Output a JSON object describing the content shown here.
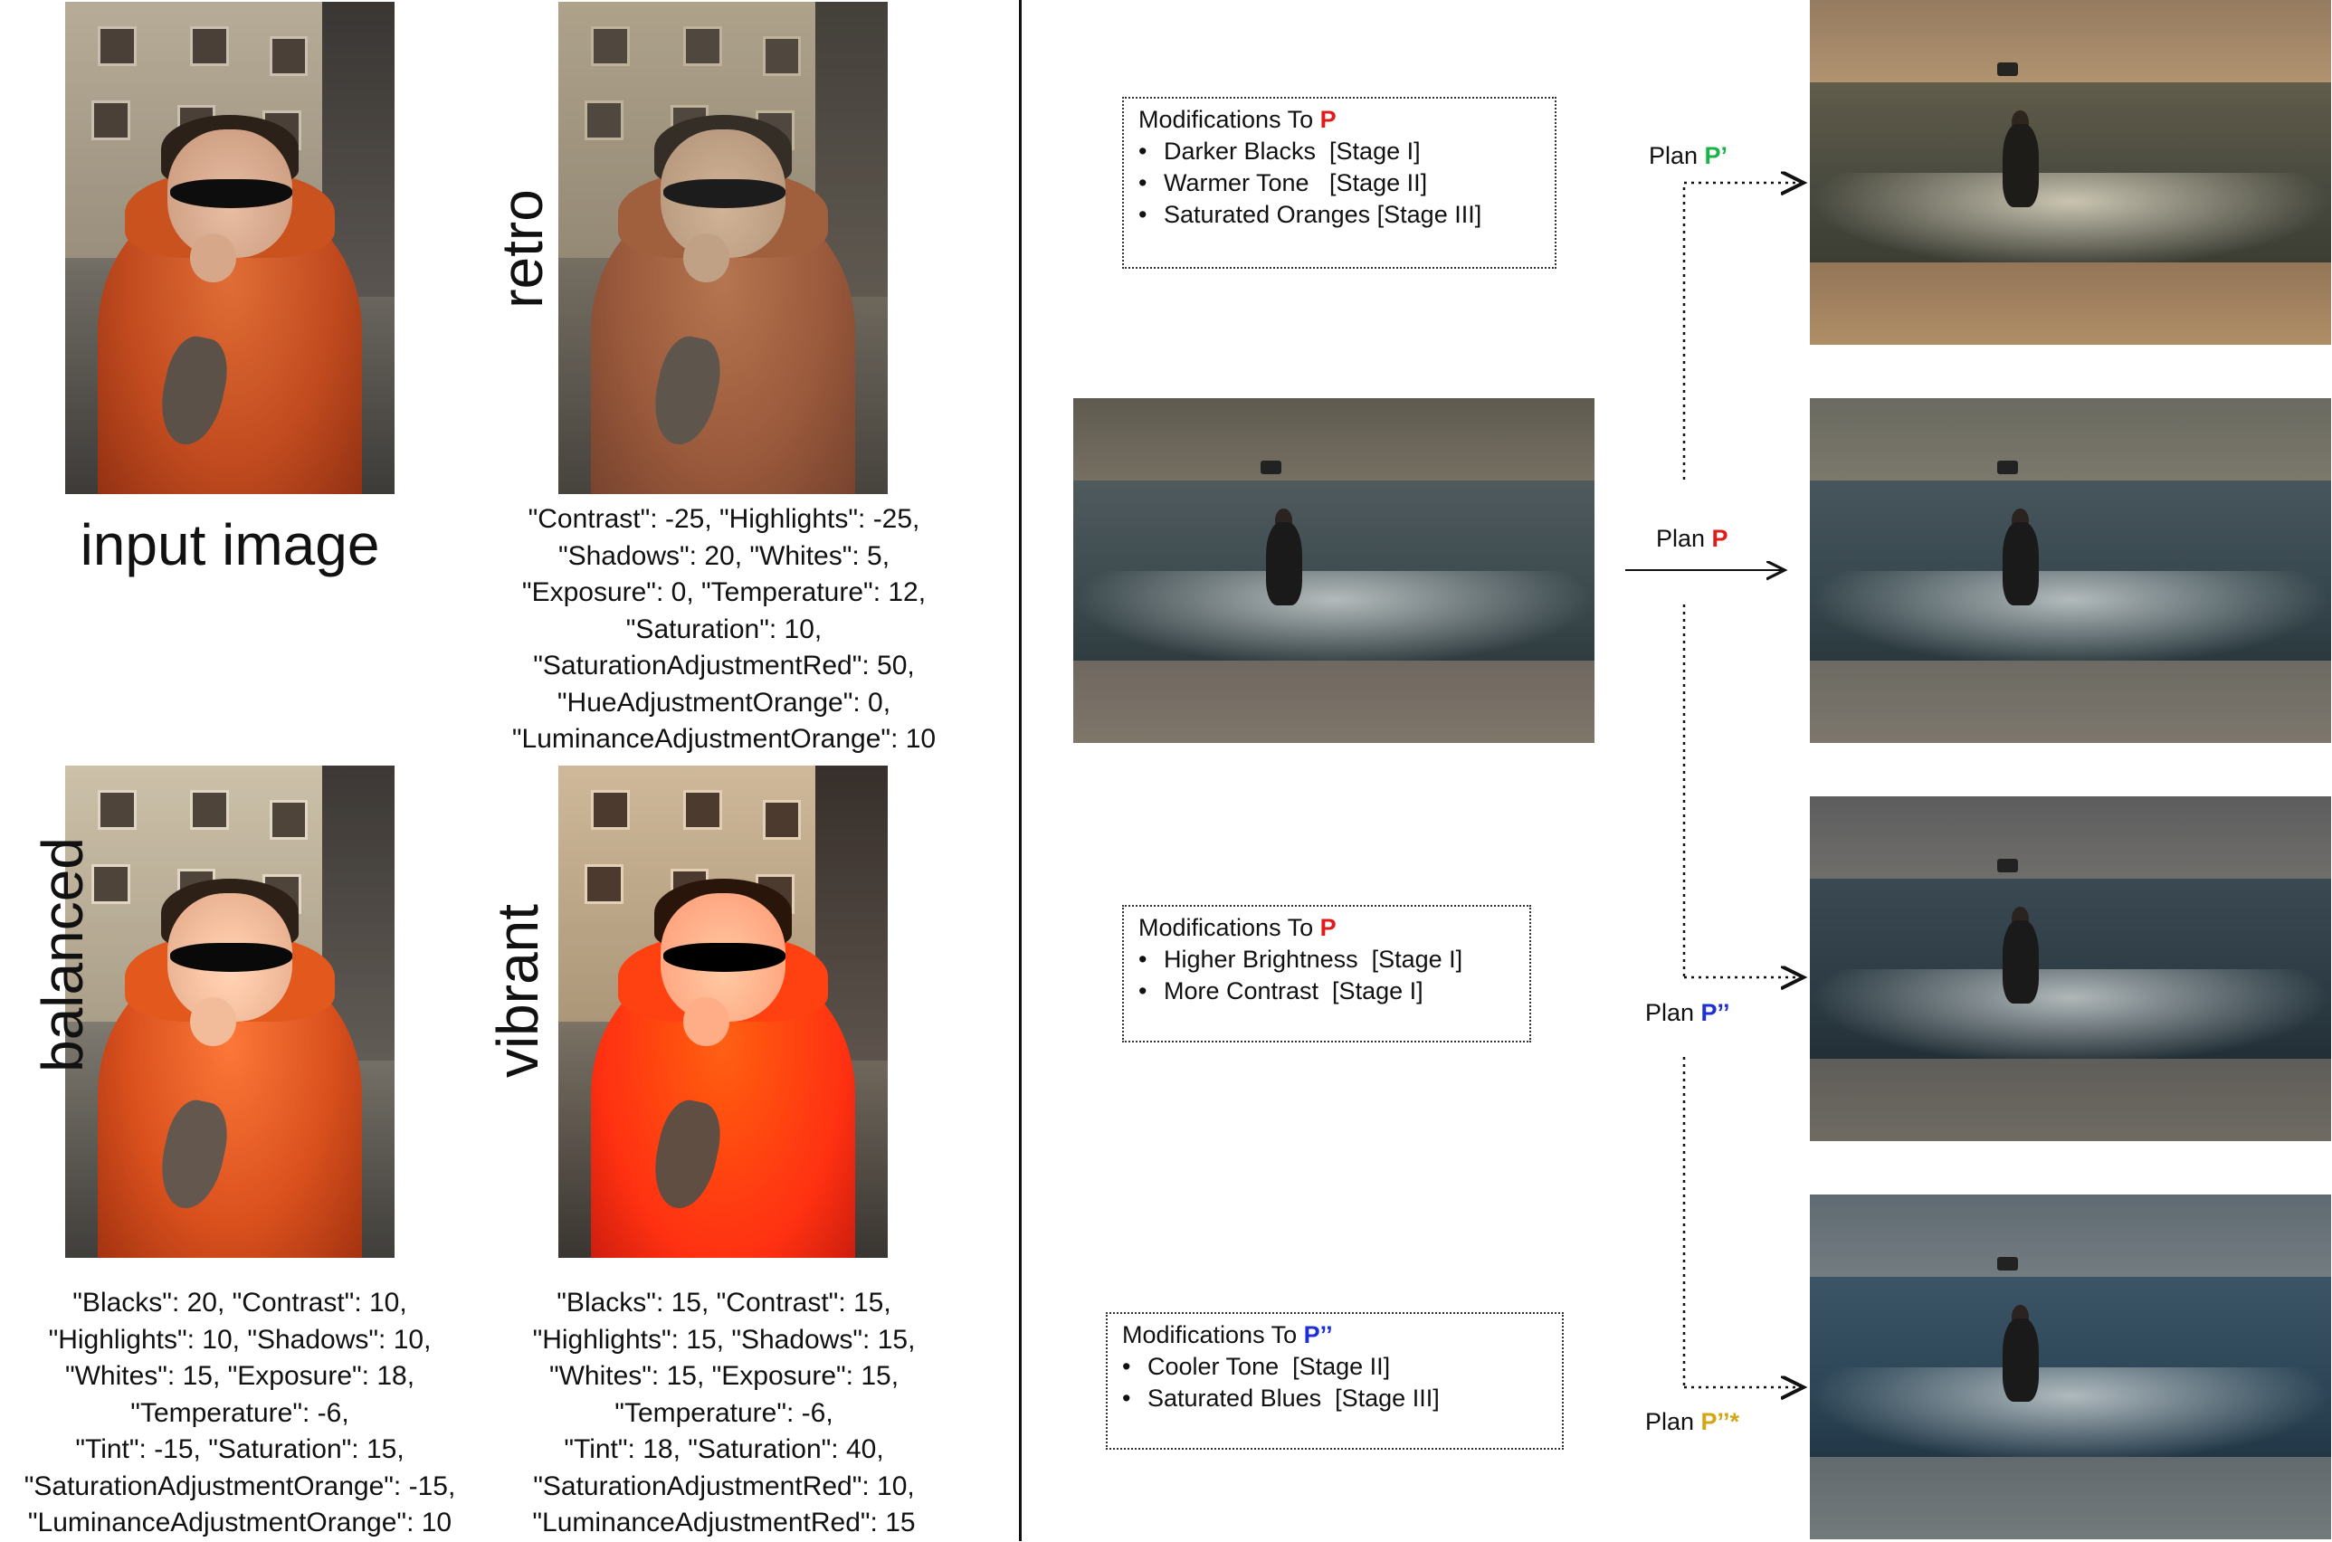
{
  "left_panel": {
    "input_label": "input image",
    "retro_label": "retro",
    "balanced_label": "balanced",
    "vibrant_label": "vibrant",
    "retro_params": [
      "\"Contrast\": -25, \"Highlights\": -25,",
      "\"Shadows\": 20, \"Whites\": 5,",
      "\"Exposure\": 0, \"Temperature\": 12,",
      "\"Saturation\": 10,",
      "\"SaturationAdjustmentRed\": 50,",
      "\"HueAdjustmentOrange\": 0,",
      "\"LuminanceAdjustmentOrange\": 10"
    ],
    "balanced_params": [
      "\"Blacks\": 20, \"Contrast\": 10,",
      "\"Highlights\": 10, \"Shadows\": 10,",
      "\"Whites\": 15, \"Exposure\": 18,",
      "\"Temperature\": -6,",
      "\"Tint\": -15, \"Saturation\": 15,",
      "\"SaturationAdjustmentOrange\": -15,",
      "\"LuminanceAdjustmentOrange\": 10"
    ],
    "vibrant_params": [
      "\"Blacks\": 15, \"Contrast\": 15,",
      "\"Highlights\": 15, \"Shadows\": 15,",
      "\"Whites\": 15, \"Exposure\": 15,",
      "\"Temperature\": -6,",
      "\"Tint\": 18, \"Saturation\": 40,",
      "\"SaturationAdjustmentRed\": 10,",
      "\"LuminanceAdjustmentRed\": 15"
    ]
  },
  "right_panel": {
    "box1": {
      "title_prefix": "Modifications To ",
      "title_plan": "P",
      "items": [
        "Darker Blacks  [Stage I]",
        "Warmer Tone   [Stage II]",
        "Saturated Oranges [Stage III]"
      ]
    },
    "box2": {
      "title_prefix": "Modifications To ",
      "title_plan": "P",
      "items": [
        "Higher Brightness  [Stage I]",
        "More Contrast  [Stage I]"
      ]
    },
    "box3": {
      "title_prefix": "Modifications To ",
      "title_plan": "P’’",
      "items": [
        "Cooler Tone  [Stage II]",
        "Saturated Blues  [Stage III]"
      ]
    },
    "plans": {
      "p_prime": {
        "prefix": "Plan ",
        "name": "P’"
      },
      "p": {
        "prefix": "Plan ",
        "name": "P"
      },
      "p_dprime": {
        "prefix": "Plan ",
        "name": "P’’"
      },
      "p_dprime_star": {
        "prefix": "Plan ",
        "name": "P’’*"
      }
    }
  },
  "colors": {
    "plan_p": "#e01b1b",
    "plan_p_prime": "#19b34a",
    "plan_p_dprime": "#1f2fd6",
    "plan_p_dprime_star": "#d4a514"
  }
}
